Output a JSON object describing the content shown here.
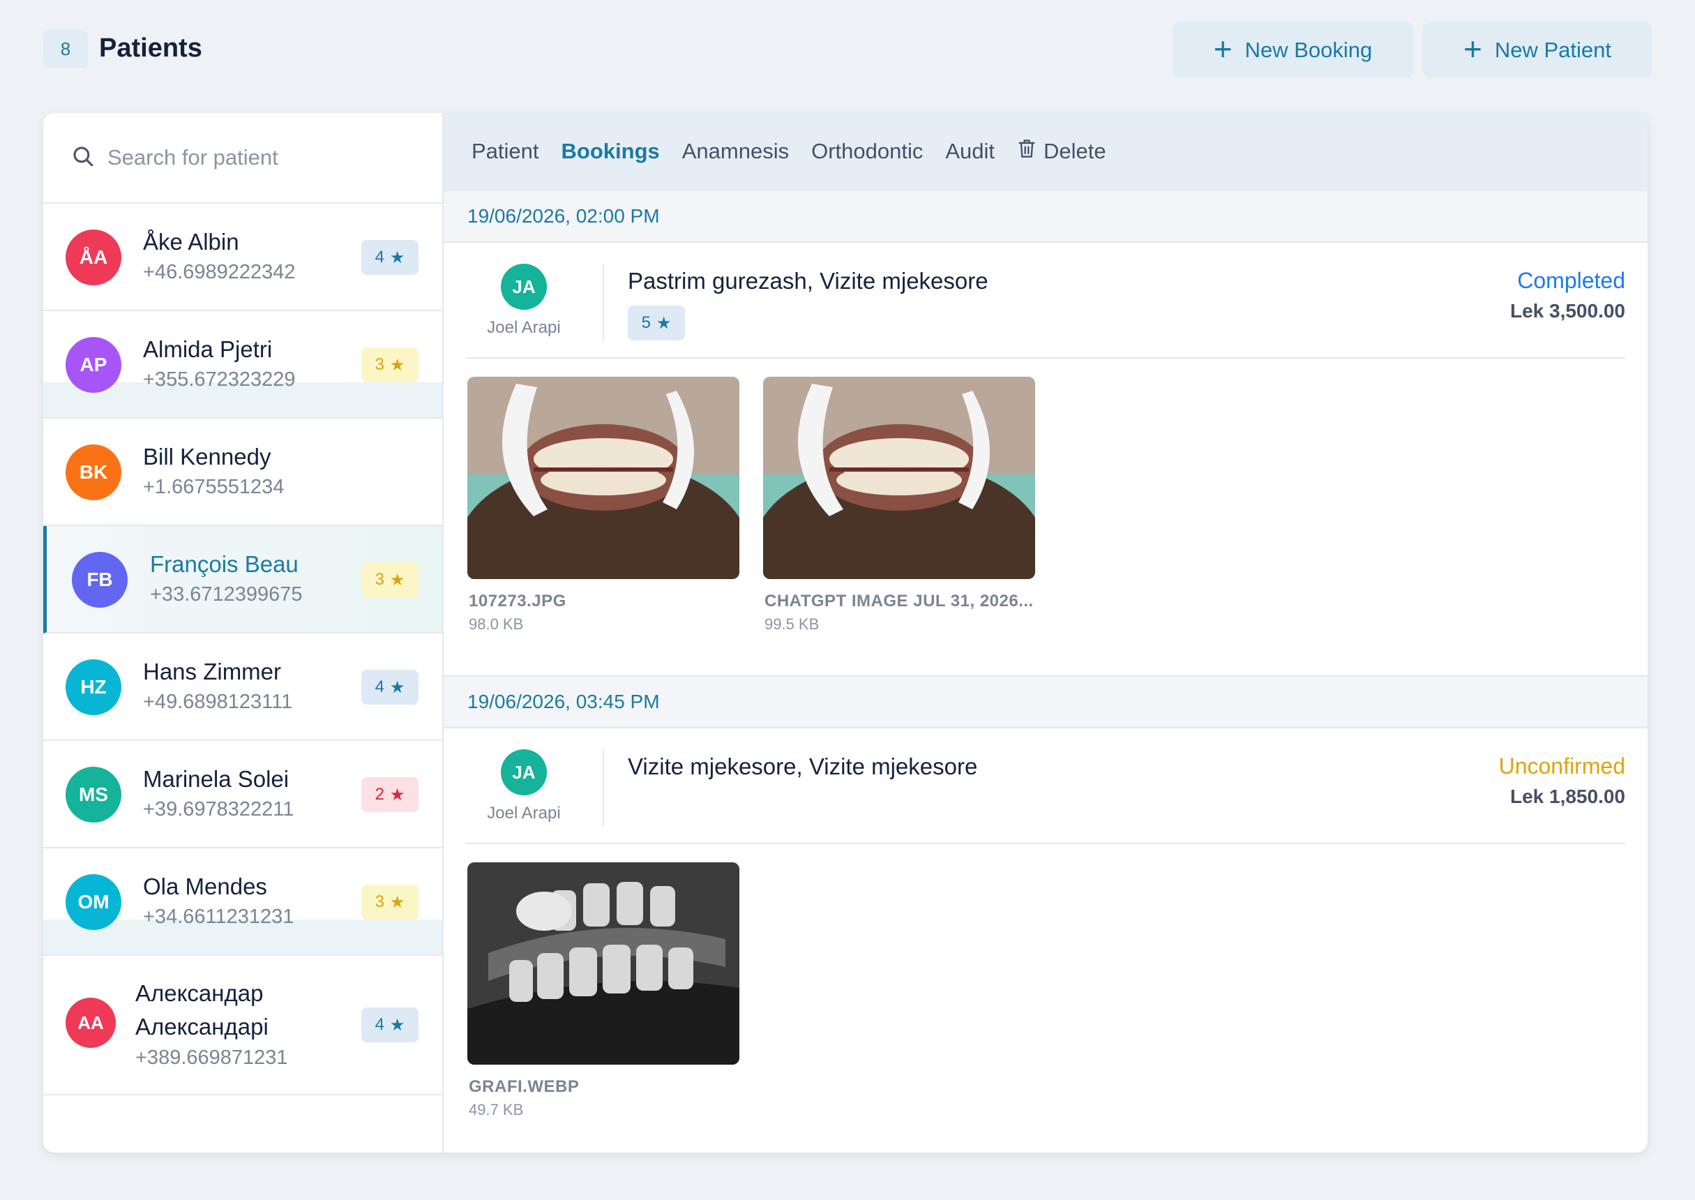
{
  "header": {
    "count": "8",
    "title": "Patients",
    "new_booking_label": "New Booking",
    "new_patient_label": "New Patient"
  },
  "search": {
    "placeholder": "Search for patient"
  },
  "patients": [
    {
      "initials": "ÅA",
      "name": "Åke Albin",
      "phone": "+46.6989222342",
      "rating": "4",
      "rating_color": "blue",
      "avatar_color": "#ee3a57"
    },
    {
      "initials": "AP",
      "name": "Almida Pjetri",
      "phone": "+355.672323229",
      "rating": "3",
      "rating_color": "yellow",
      "avatar_color": "#a855f7"
    },
    {
      "initials": "BK",
      "name": "Bill Kennedy",
      "phone": "+1.6675551234",
      "rating": "",
      "rating_color": "",
      "avatar_color": "#f97316"
    },
    {
      "initials": "FB",
      "name": "François Beau",
      "phone": "+33.6712399675",
      "rating": "3",
      "rating_color": "yellow",
      "avatar_color": "#6366f1",
      "selected": true
    },
    {
      "initials": "HZ",
      "name": "Hans Zimmer",
      "phone": "+49.6898123111",
      "rating": "4",
      "rating_color": "blue",
      "avatar_color": "#06b6d4"
    },
    {
      "initials": "MS",
      "name": "Marinela Solei",
      "phone": "+39.6978322211",
      "rating": "2",
      "rating_color": "red",
      "avatar_color": "#14b39a"
    },
    {
      "initials": "OM",
      "name": "Ola Mendes",
      "phone": "+34.6611231231",
      "rating": "3",
      "rating_color": "yellow",
      "avatar_color": "#06b6d4"
    },
    {
      "initials": "AA",
      "name": "Александар Александарi",
      "phone": "+389.669871231",
      "rating": "4",
      "rating_color": "blue",
      "avatar_color": "#ee3a57"
    }
  ],
  "tabs": [
    {
      "label": "Patient",
      "active": false
    },
    {
      "label": "Bookings",
      "active": true
    },
    {
      "label": "Anamnesis",
      "active": false
    },
    {
      "label": "Orthodontic",
      "active": false
    },
    {
      "label": "Audit",
      "active": false
    },
    {
      "label": "Delete",
      "icon": "trash-icon"
    }
  ],
  "bookings": [
    {
      "date": "19/06/2026, 02:00 PM",
      "doctor_initials": "JA",
      "doctor_name": "Joel Arapi",
      "services": "Pastrim gurezash, Vizite mjekesore",
      "rating": "5",
      "status": "Completed",
      "price": "Lek 3,500.00",
      "files": [
        {
          "name": "107273.JPG",
          "size": "98.0 KB"
        },
        {
          "name": "CHATGPT IMAGE JUL 31, 2026...",
          "size": "99.5 KB"
        }
      ]
    },
    {
      "date": "19/06/2026, 03:45 PM",
      "doctor_initials": "JA",
      "doctor_name": "Joel Arapi",
      "services": "Vizite mjekesore, Vizite mjekesore",
      "status": "Unconfirmed",
      "price": "Lek 1,850.00",
      "files": [
        {
          "name": "GRAFI.WEBP",
          "size": "49.7 KB"
        }
      ]
    }
  ],
  "colors": {
    "accent": "#1a7aa3",
    "completed": "#1f7ae8",
    "unconfirmed": "#e0a30f"
  }
}
